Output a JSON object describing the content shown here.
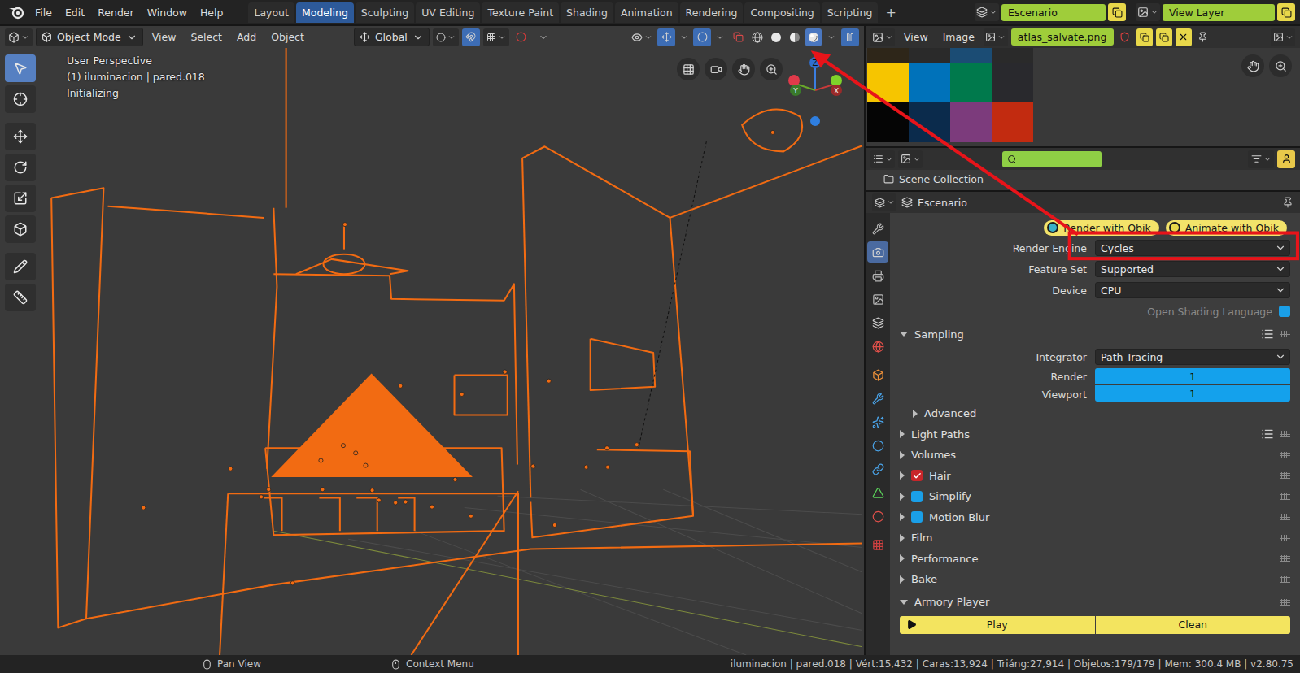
{
  "topbar": {
    "menus": [
      "File",
      "Edit",
      "Render",
      "Window",
      "Help"
    ],
    "workspaces": [
      {
        "label": "Layout",
        "selected": false
      },
      {
        "label": "Modeling",
        "selected": true
      },
      {
        "label": "Sculpting",
        "selected": false
      },
      {
        "label": "UV Editing",
        "selected": false
      },
      {
        "label": "Texture Paint",
        "selected": false
      },
      {
        "label": "Shading",
        "selected": false
      },
      {
        "label": "Animation",
        "selected": false
      },
      {
        "label": "Rendering",
        "selected": false
      },
      {
        "label": "Compositing",
        "selected": false
      },
      {
        "label": "Scripting",
        "selected": false
      }
    ],
    "add_tab": "+",
    "scene": "Escenario",
    "view_layer": "View Layer"
  },
  "viewport": {
    "mode": "Object Mode",
    "menus": [
      "View",
      "Select",
      "Add",
      "Object"
    ],
    "orientation": "Global",
    "shading": [
      {
        "kind": "wireframe",
        "selected": false
      },
      {
        "kind": "solid",
        "selected": false
      },
      {
        "kind": "material",
        "selected": false
      },
      {
        "kind": "rendered",
        "selected": true
      }
    ],
    "info": [
      "User Perspective",
      "(1) iluminacion | pared.018",
      "Initializing"
    ],
    "gizmo": {
      "z": "Z",
      "x": "X",
      "y": "Y"
    },
    "tools": [
      {
        "kind": "select",
        "selected": true
      },
      {
        "kind": "cursor",
        "selected": false
      },
      {
        "kind": "move",
        "selected": false
      },
      {
        "kind": "rotate",
        "selected": false
      },
      {
        "kind": "scale",
        "selected": false
      },
      {
        "kind": "transform",
        "selected": false
      },
      {
        "kind": "annotate",
        "selected": false
      },
      {
        "kind": "measure",
        "selected": false
      }
    ]
  },
  "image_editor": {
    "menus": [
      "View",
      "Image"
    ],
    "image_name": "atlas_salvate.png",
    "swatches": [
      [
        "#2e2619",
        "#2a2a2a",
        "#1b4c74",
        "#2a2a2a"
      ],
      [
        "#f6c500",
        "#0072ba",
        "#00794c",
        "#29292d"
      ],
      [
        "#050505",
        "#0b2b4c",
        "#7c3b7c",
        "#c22b10"
      ]
    ]
  },
  "outliner": {
    "items": [
      "Scene Collection"
    ]
  },
  "properties": {
    "context": "Escenario",
    "tabs": [
      {
        "kind": "tool",
        "selected": false,
        "color": "#b8b8b8"
      },
      {
        "kind": "render",
        "selected": true,
        "color": "#d0d0d0"
      },
      {
        "kind": "output",
        "selected": false,
        "color": "#b8b8b8"
      },
      {
        "kind": "view_layer",
        "selected": false,
        "color": "#b8b8b8"
      },
      {
        "kind": "scene",
        "selected": false,
        "color": "#c8c8c8"
      },
      {
        "kind": "world",
        "selected": false,
        "color": "#e0504a"
      },
      {
        "kind": "object",
        "selected": false,
        "color": "#f0923a"
      },
      {
        "kind": "modifiers",
        "selected": false,
        "color": "#4aa3e8"
      },
      {
        "kind": "particles",
        "selected": false,
        "color": "#4aa3e8"
      },
      {
        "kind": "physics",
        "selected": false,
        "color": "#4aa3e8"
      },
      {
        "kind": "constraints",
        "selected": false,
        "color": "#4aa3e8"
      },
      {
        "kind": "data",
        "selected": false,
        "color": "#5cd65c"
      },
      {
        "kind": "material",
        "selected": false,
        "color": "#e0504a"
      },
      {
        "kind": "texture",
        "selected": false,
        "color": "#d04040"
      }
    ],
    "addon_buttons": [
      "Render with Qbik",
      "Animate with Qbik"
    ],
    "rows": [
      {
        "kind": "dropdown",
        "label": "Render Engine",
        "value": "Cycles"
      },
      {
        "kind": "dropdown",
        "label": "Feature Set",
        "value": "Supported"
      },
      {
        "kind": "dropdown",
        "label": "Device",
        "value": "CPU"
      },
      {
        "kind": "checkbox",
        "label": "Open Shading Language",
        "checked": false,
        "disabled": true
      },
      {
        "kind": "panel",
        "label": "Sampling",
        "expanded": true,
        "presets": true
      },
      {
        "kind": "dropdown",
        "label": "Integrator",
        "value": "Path Tracing"
      },
      {
        "kind": "number",
        "label": "Render",
        "value": "1"
      },
      {
        "kind": "number",
        "label": "Viewport",
        "value": "1"
      },
      {
        "kind": "subpanel",
        "label": "Advanced",
        "expanded": false
      },
      {
        "kind": "panel",
        "label": "Light Paths",
        "expanded": false,
        "presets": true
      },
      {
        "kind": "panel",
        "label": "Volumes",
        "expanded": false,
        "presets": false
      },
      {
        "kind": "check-panel",
        "label": "Hair",
        "expanded": false,
        "checked": true
      },
      {
        "kind": "check-panel",
        "label": "Simplify",
        "expanded": false,
        "checked": false
      },
      {
        "kind": "check-panel",
        "label": "Motion Blur",
        "expanded": false,
        "checked": false
      },
      {
        "kind": "panel",
        "label": "Film",
        "expanded": false,
        "presets": false
      },
      {
        "kind": "panel",
        "label": "Performance",
        "expanded": false,
        "presets": false
      },
      {
        "kind": "panel",
        "label": "Bake",
        "expanded": false,
        "presets": false
      },
      {
        "kind": "panel",
        "label": "Armory Player",
        "expanded": true,
        "presets": false
      },
      {
        "kind": "buttons",
        "items": [
          {
            "label": "Play",
            "icon": true
          },
          {
            "label": "Clean",
            "icon": false
          }
        ]
      }
    ]
  },
  "status_bar": {
    "hints": [
      "Pan View",
      "Context Menu"
    ],
    "info": "iluminacion | pared.018 | Vért:15,432 | Caras:13,924 | Triáng:27,914 | Objetos:179/179 | Mem: 300.4 MB | v2.80.75"
  }
}
